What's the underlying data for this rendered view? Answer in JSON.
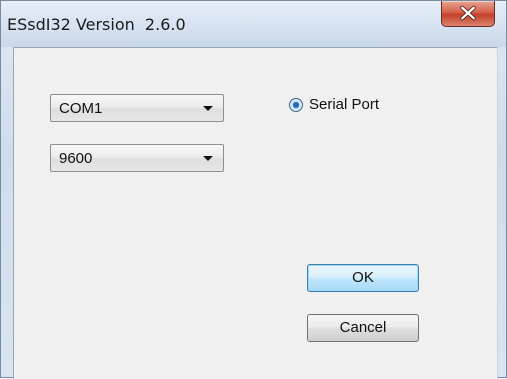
{
  "window": {
    "title": "ESsdI32 Version  2.6.0"
  },
  "controls": {
    "port_combo": {
      "value": "COM1"
    },
    "baud_combo": {
      "value": "9600"
    },
    "serial_port_radio": {
      "label": "Serial Port",
      "checked": true
    }
  },
  "buttons": {
    "ok_label": "OK",
    "cancel_label": "Cancel"
  },
  "icons": {
    "close": "close-icon",
    "dropdown": "chevron-down-icon",
    "radio": "radio-selected-icon"
  },
  "colors": {
    "close_button": "#c94a35",
    "default_button_border": "#3c7fb1",
    "radio_dot": "#1f5fa8"
  }
}
